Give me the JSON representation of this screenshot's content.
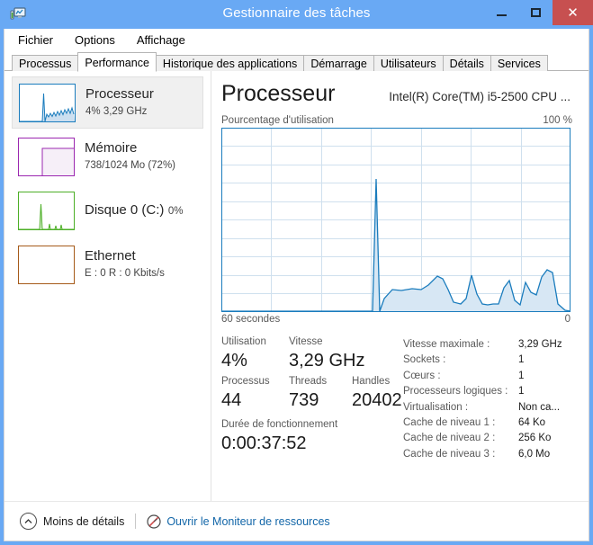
{
  "window": {
    "title": "Gestionnaire des tâches",
    "icon": "task-manager-icon",
    "controls": {
      "minimize": "−",
      "maximize": "□",
      "close": "✕"
    }
  },
  "menu": {
    "items": [
      "Fichier",
      "Options",
      "Affichage"
    ]
  },
  "tabs": {
    "active": "Performance",
    "items": [
      "Processus",
      "Performance",
      "Historique des applications",
      "Démarrage",
      "Utilisateurs",
      "Détails",
      "Services"
    ]
  },
  "sidebar": {
    "items": [
      {
        "name": "Processeur",
        "sub": "4% 3,29 GHz",
        "color": "#1a7cbd",
        "selected": true
      },
      {
        "name": "Mémoire",
        "sub": "738/1024 Mo (72%)",
        "color": "#9b27b0",
        "selected": false
      },
      {
        "name": "Disque 0 (C:)",
        "sub": "0%",
        "color": "#4caf26",
        "selected": false
      },
      {
        "name": "Ethernet",
        "sub": "E : 0 R : 0 Kbits/s",
        "color": "#a55a19",
        "selected": false
      }
    ]
  },
  "main": {
    "title": "Processeur",
    "cpu_name": "Intel(R) Core(TM) i5-2500 CPU ...",
    "graph_caption_left": "Pourcentage d'utilisation",
    "graph_caption_right": "100 %",
    "graph_foot_left": "60 secondes",
    "graph_foot_right": "0",
    "accent_color": "#1a7cbd",
    "stats": [
      {
        "label": "Utilisation",
        "value": "4%"
      },
      {
        "label": "Vitesse",
        "value": "3,29 GHz"
      },
      {
        "label": "Processus",
        "value": "44"
      },
      {
        "label": "Threads",
        "value": "739"
      },
      {
        "label": "Handles",
        "value": "20402"
      }
    ],
    "uptime": {
      "label": "Durée de fonctionnement",
      "value": "0:00:37:52"
    },
    "specs": [
      {
        "label": "Vitesse maximale :",
        "value": "3,29 GHz"
      },
      {
        "label": "Sockets :",
        "value": "1"
      },
      {
        "label": "Cœurs :",
        "value": "1"
      },
      {
        "label": "Processeurs logiques :",
        "value": "1"
      },
      {
        "label": "Virtualisation :",
        "value": "Non ca..."
      },
      {
        "label": "Cache de niveau 1 :",
        "value": "64 Ko"
      },
      {
        "label": "Cache de niveau 2 :",
        "value": "256 Ko"
      },
      {
        "label": "Cache de niveau 3 :",
        "value": "6,0 Mo"
      }
    ]
  },
  "chart_data": {
    "type": "area",
    "title": "Pourcentage d'utilisation",
    "xlabel": "60 secondes",
    "ylabel": "%",
    "ylim": [
      0,
      100
    ],
    "xlim": [
      0,
      60
    ],
    "grid": true,
    "legend": null,
    "series": [
      {
        "name": "Pourcentage d'utilisation du processeur",
        "color": "#1a7cbd",
        "x": [
          0,
          4,
          8,
          12,
          16,
          20,
          24,
          25,
          26,
          27,
          28,
          29,
          30,
          31,
          32,
          33,
          34,
          35,
          36,
          37,
          38,
          39,
          40,
          41,
          42,
          43,
          44,
          45,
          46,
          47,
          48,
          49,
          50,
          51,
          52,
          53,
          54,
          55,
          56,
          57,
          58,
          59,
          60
        ],
        "values": [
          0,
          0,
          0,
          0,
          0,
          0,
          0,
          0,
          72,
          40,
          5,
          4,
          9,
          8,
          10,
          9,
          8,
          9,
          9,
          10,
          20,
          18,
          9,
          3,
          2,
          4,
          20,
          8,
          2,
          2,
          3,
          3,
          3,
          17,
          11,
          4,
          15,
          10,
          8,
          18,
          23,
          21,
          2
        ]
      }
    ]
  },
  "statusbar": {
    "details_label": "Moins de détails",
    "details_icon": "chevron-up-icon",
    "link_label": "Ouvrir le Moniteur de ressources",
    "link_icon": "resource-monitor-icon",
    "link_color": "#1266a8"
  }
}
